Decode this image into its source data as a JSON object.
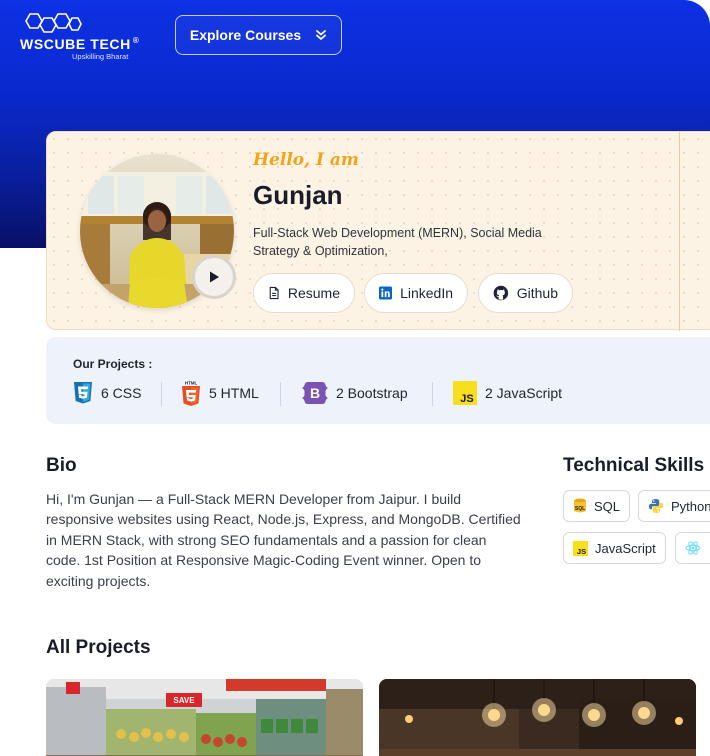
{
  "header": {
    "logo_text": "WsCube Tech",
    "logo_reg": "®",
    "logo_tagline": "Upskilling Bharat",
    "explore_label": "Explore Courses"
  },
  "profile": {
    "greeting": "Hello, I am",
    "name": "Gunjan",
    "role": "Full-Stack Web Development (MERN), Social Media Strategy & Optimization,",
    "buttons": {
      "resume": "Resume",
      "linkedin": "LinkedIn",
      "github": "Github"
    }
  },
  "projects_summary": {
    "heading": "Our Projects :",
    "items": [
      {
        "label": "6 CSS",
        "icon": "css3-icon",
        "color": "#1572b6"
      },
      {
        "label": "5 HTML",
        "icon": "html5-icon",
        "color": "#e44d26"
      },
      {
        "label": "2 Bootstrap",
        "icon": "bootstrap-icon",
        "color": "#7952b3"
      },
      {
        "label": "2 JavaScript",
        "icon": "javascript-icon",
        "color": "#f7df1e"
      }
    ]
  },
  "bio": {
    "title": "Bio",
    "text": "Hi, I'm Gunjan — a Full-Stack MERN Developer from Jaipur. I build responsive websites using React, Node.js, Express, and MongoDB. Certified in MERN Stack, with strong SEO fundamentals and a passion for clean code. 1st Position at Responsive Magic-Coding Event winner. Open to exciting projects."
  },
  "skills": {
    "title": "Technical Skills",
    "items": [
      {
        "label": "SQL",
        "icon": "sql-icon"
      },
      {
        "label": "Python",
        "icon": "python-icon"
      },
      {
        "label": "JavaScript",
        "icon": "javascript-icon"
      },
      {
        "label": "",
        "icon": "react-icon"
      }
    ]
  },
  "all_projects": {
    "title": "All Projects",
    "thumbnail_1": {
      "sign": "SAVE"
    },
    "thumbnail_2": {
      "icon": "cafe-lights-image"
    }
  },
  "colors": {
    "brand_blue": "#0d31e4",
    "accent_orange": "#f0a419",
    "card_cream": "#fdf3e4",
    "strip_blue": "#eef2fb"
  }
}
